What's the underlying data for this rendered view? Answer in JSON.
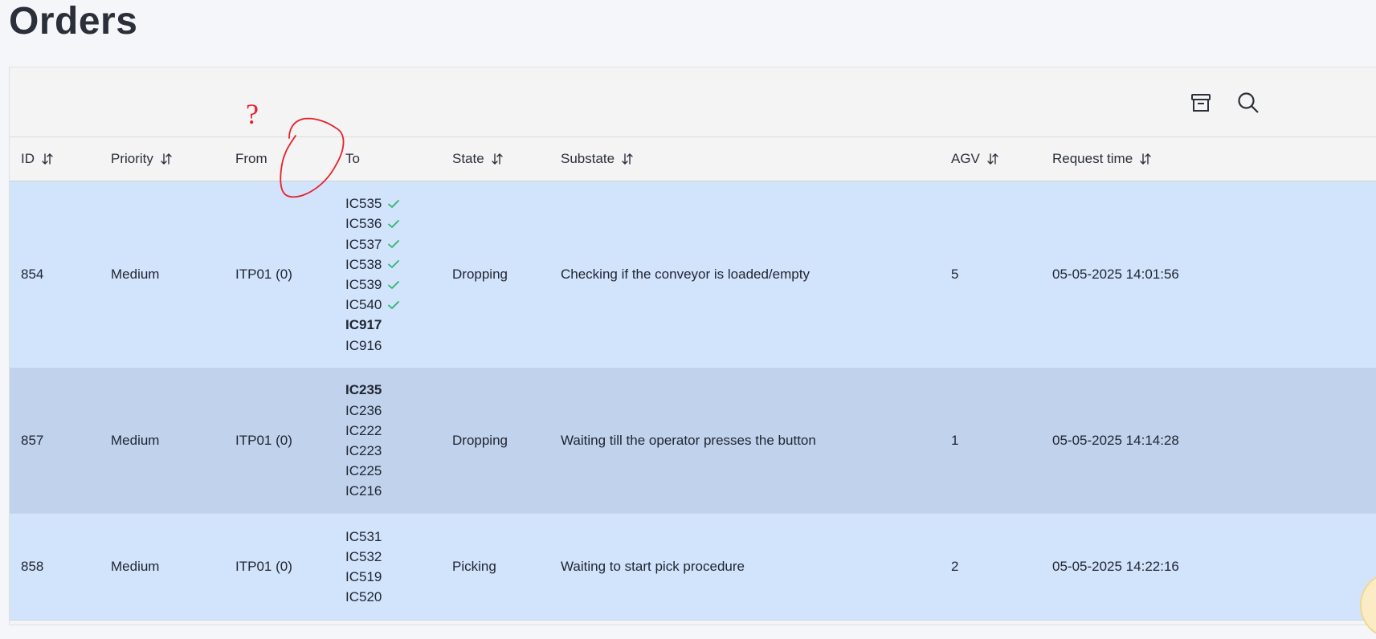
{
  "page": {
    "title": "Orders"
  },
  "toolbar": {
    "archive_icon": "archive-icon",
    "search_icon": "search-icon"
  },
  "table": {
    "columns": [
      {
        "key": "id",
        "label": "ID",
        "sortable": true
      },
      {
        "key": "priority",
        "label": "Priority",
        "sortable": true
      },
      {
        "key": "from",
        "label": "From",
        "sortable": false
      },
      {
        "key": "to",
        "label": "To",
        "sortable": false
      },
      {
        "key": "state",
        "label": "State",
        "sortable": true
      },
      {
        "key": "substate",
        "label": "Substate",
        "sortable": true
      },
      {
        "key": "agv",
        "label": "AGV",
        "sortable": true
      },
      {
        "key": "request_time",
        "label": "Request time",
        "sortable": true
      }
    ],
    "rows": [
      {
        "id": "854",
        "priority": "Medium",
        "from": "ITP01 (0)",
        "to": [
          {
            "name": "IC535",
            "done": true,
            "current": false
          },
          {
            "name": "IC536",
            "done": true,
            "current": false
          },
          {
            "name": "IC537",
            "done": true,
            "current": false
          },
          {
            "name": "IC538",
            "done": true,
            "current": false
          },
          {
            "name": "IC539",
            "done": true,
            "current": false
          },
          {
            "name": "IC540",
            "done": true,
            "current": false
          },
          {
            "name": "IC917",
            "done": false,
            "current": true
          },
          {
            "name": "IC916",
            "done": false,
            "current": false
          }
        ],
        "state": "Dropping",
        "substate": "Checking if the conveyor is loaded/empty",
        "agv": "5",
        "request_time": "05-05-2025 14:01:56"
      },
      {
        "id": "857",
        "priority": "Medium",
        "from": "ITP01 (0)",
        "to": [
          {
            "name": "IC235",
            "done": false,
            "current": true
          },
          {
            "name": "IC236",
            "done": false,
            "current": false
          },
          {
            "name": "IC222",
            "done": false,
            "current": false
          },
          {
            "name": "IC223",
            "done": false,
            "current": false
          },
          {
            "name": "IC225",
            "done": false,
            "current": false
          },
          {
            "name": "IC216",
            "done": false,
            "current": false
          }
        ],
        "state": "Dropping",
        "substate": "Waiting till the operator presses the button",
        "agv": "1",
        "request_time": "05-05-2025 14:14:28"
      },
      {
        "id": "858",
        "priority": "Medium",
        "from": "ITP01 (0)",
        "to": [
          {
            "name": "IC531",
            "done": false,
            "current": false
          },
          {
            "name": "IC532",
            "done": false,
            "current": false
          },
          {
            "name": "IC519",
            "done": false,
            "current": false
          },
          {
            "name": "IC520",
            "done": false,
            "current": false
          }
        ],
        "state": "Picking",
        "substate": "Waiting to start pick procedure",
        "agv": "2",
        "request_time": "05-05-2025 14:22:16"
      }
    ]
  },
  "annotation": {
    "mark": "?",
    "color": "#e8202a"
  },
  "colors": {
    "row_bg": "#d2e3fc",
    "row_bg_alt": "#c0d2ec",
    "check": "#2fb56a"
  }
}
